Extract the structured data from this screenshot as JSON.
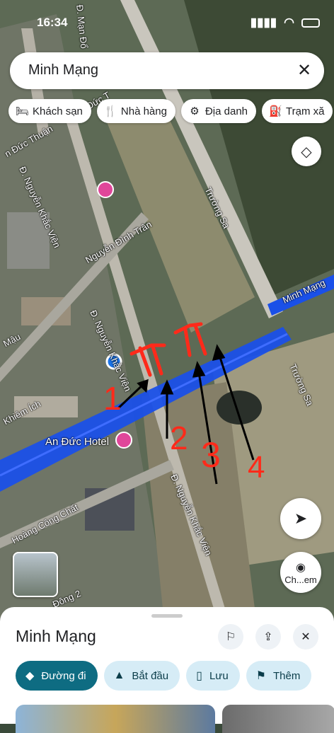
{
  "status": {
    "time": "16:34"
  },
  "search": {
    "query": "Minh Mạng"
  },
  "chips": [
    {
      "icon": "bed-icon",
      "label": "Khách sạn"
    },
    {
      "icon": "fork-knife-icon",
      "label": "Nhà hàng"
    },
    {
      "icon": "camera-icon",
      "label": "Địa danh"
    },
    {
      "icon": "fuel-icon",
      "label": "Trạm xă"
    }
  ],
  "map_labels": {
    "minh_mang": "Minh Mạng",
    "truong_sa_top": "Trường Sa",
    "truong_sa_right": "Trường Sa",
    "nguyen_dinh_tran": "Nguyễn Đình Trân",
    "d_nguyen_khac_vien_left": "Đ. Nguyễn Khắc Viện",
    "d_nguyen_khac_vien_mid": "Đ. Nguyễn Khắc Viện",
    "d_nguyen_khac_vien_bottom": "Đ. Nguyễn Khắc Viện",
    "d_man_de": "Đ. Mạn Đổ",
    "duc_thuan": "n Đức Thuận",
    "duc_t": "n Đức T",
    "mau": "Mậu",
    "khiem_ich": "Khiêm Ích",
    "hoang_cong_chat": "Hoàng Công Chất",
    "an_duc_hotel": "An Đức Hotel",
    "dong_2": "Đông 2"
  },
  "annotations": [
    "1",
    "2",
    "3",
    "4"
  ],
  "buttons": {
    "chem": "Ch...em"
  },
  "sheet": {
    "title": "Minh Mạng",
    "actions": [
      {
        "icon": "directions-icon",
        "label": "Đường đi"
      },
      {
        "icon": "navigate-icon",
        "label": "Bắt đầu"
      },
      {
        "icon": "bookmark-icon",
        "label": "Lưu"
      },
      {
        "icon": "flag-icon",
        "label": "Thêm"
      }
    ]
  }
}
